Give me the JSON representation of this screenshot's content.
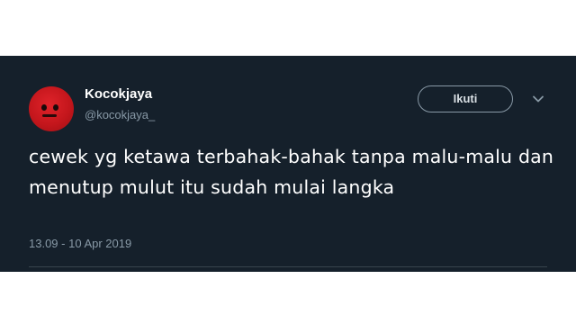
{
  "tweet": {
    "author": {
      "display_name": "Kocokjaya",
      "handle": "@kocokjaya_"
    },
    "follow_button_label": "Ikuti",
    "text": "cewek yg ketawa terbahak-bahak tanpa malu-malu dan menutup mulut itu sudah mulai langka",
    "timestamp": "13.09 - 10 Apr 2019",
    "icons": {
      "more": "chevron-down-icon",
      "avatar": "avatar-image"
    },
    "colors": {
      "background": "#15202b",
      "text": "#ffffff",
      "secondary_text": "#8899a6",
      "avatar": "#c4161c"
    }
  }
}
